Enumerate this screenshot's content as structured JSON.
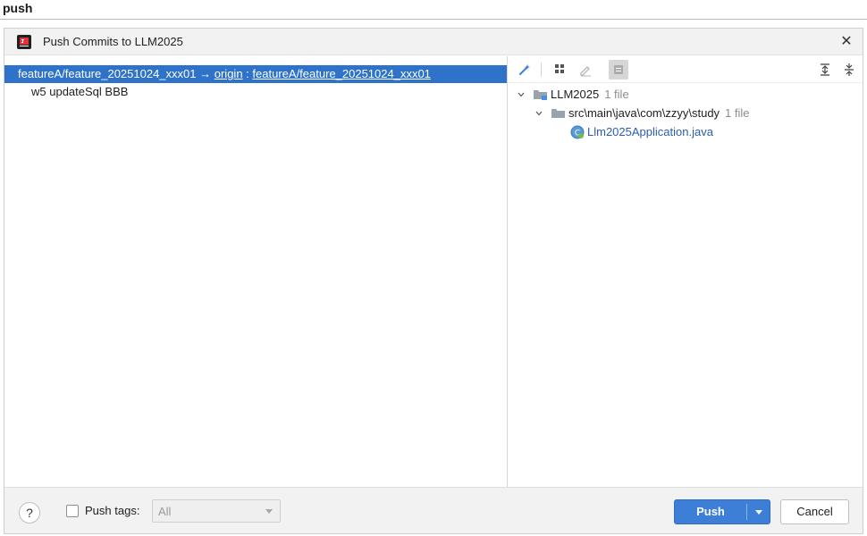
{
  "caption": {
    "text": "push"
  },
  "dialog": {
    "title": "Push Commits to LLM2025",
    "close_icon": "close-icon",
    "app_icon": "intellij-app-icon"
  },
  "left_pane": {
    "branch": {
      "local": "featureA/feature_20251024_xxx01",
      "arrow": "→",
      "remote": "origin",
      "separator": ":",
      "remote_branch": "featureA/feature_20251024_xxx01"
    },
    "commits": [
      "w5 updateSql BBB"
    ]
  },
  "toolbar": {
    "buttons": [
      "magic-wand-icon",
      "group-by-icon",
      "edit-icon",
      "show-diff-icon",
      "expand-all-icon",
      "collapse-all-icon"
    ]
  },
  "tree": {
    "root": {
      "label": "LLM2025",
      "count": "1 file"
    },
    "folder": {
      "label": "src\\main\\java\\com\\zzyy\\study",
      "count": "1 file"
    },
    "file": {
      "label": "Llm2025Application.java"
    }
  },
  "footer": {
    "help_label": "?",
    "push_tags_label": "Push tags:",
    "push_tags_checked": false,
    "tags_select_value": "All",
    "push_label": "Push",
    "cancel_label": "Cancel"
  },
  "colors": {
    "selection": "#2e73c9",
    "primary_button": "#3d7fd6",
    "link": "#2a5db0",
    "muted": "#8c8c8c"
  }
}
